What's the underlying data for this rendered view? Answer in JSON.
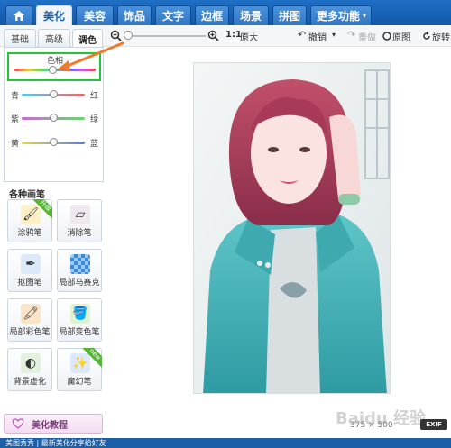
{
  "nav": {
    "tabs": [
      {
        "label": "美化",
        "active": true
      },
      {
        "label": "美容"
      },
      {
        "label": "饰品"
      },
      {
        "label": "文字"
      },
      {
        "label": "边框"
      },
      {
        "label": "场景"
      },
      {
        "label": "拼图"
      },
      {
        "label": "更多功能"
      }
    ]
  },
  "subtabs": [
    "基础",
    "高级",
    "调色"
  ],
  "toolbar": {
    "zoom_ratio": "1:1",
    "original_size": "原大",
    "undo": "撤销",
    "redo": "重做",
    "original": "原图",
    "rotate": "旋转"
  },
  "adjust": {
    "hue_label": "色相",
    "cyan": "青",
    "red": "红",
    "magenta": "紫",
    "green": "绿",
    "yellow": "黄",
    "blue": "蓝",
    "hue_value": 0.45,
    "cyan_red_value": 0.5,
    "magenta_green_value": 0.5,
    "yellow_blue_value": 0.5
  },
  "brushes": {
    "title": "各种画笔",
    "items": [
      {
        "label": "涂鸦笔",
        "icon": "brush-icon",
        "badge": "升级"
      },
      {
        "label": "消除笔",
        "icon": "eraser-icon"
      },
      {
        "label": "抠图笔",
        "icon": "pen-cutout-icon"
      },
      {
        "label": "局部马赛克",
        "icon": "mosaic-icon"
      },
      {
        "label": "局部彩色笔",
        "icon": "color-pen-icon"
      },
      {
        "label": "局部变色笔",
        "icon": "paint-bucket-icon"
      },
      {
        "label": "背景虚化",
        "icon": "blur-icon"
      },
      {
        "label": "魔幻笔",
        "icon": "magic-pen-icon",
        "badge": "new"
      }
    ]
  },
  "tutorial": {
    "label": "美化教程"
  },
  "image_info": {
    "width": "375",
    "x": "×",
    "height": "500",
    "exif": "EXIF"
  },
  "watermark": "Baidu 经验",
  "statusbar": "美图秀秀 | 最新美化分享给好友"
}
